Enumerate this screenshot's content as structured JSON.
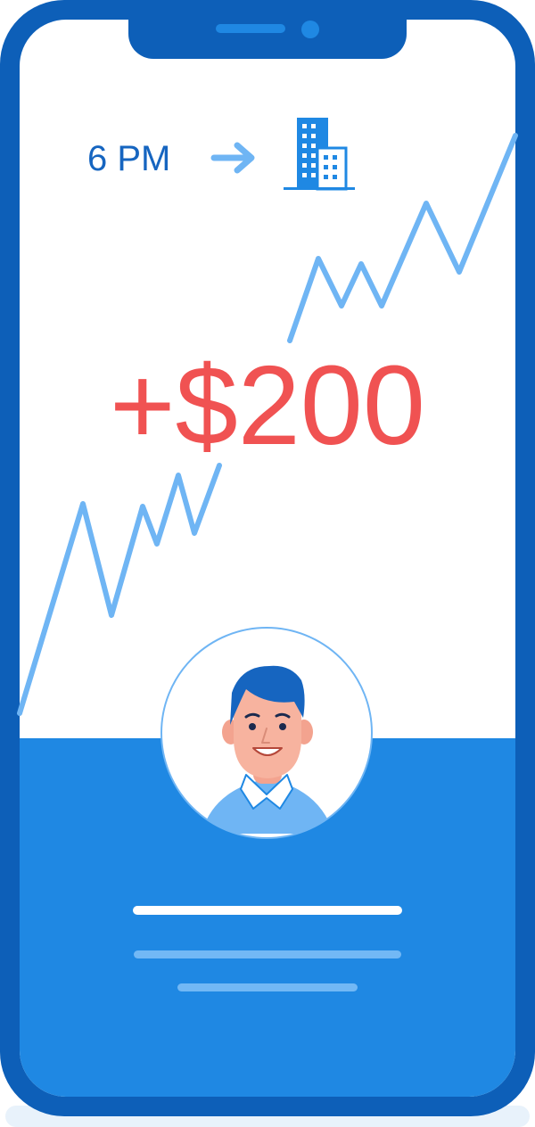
{
  "time": {
    "label": "6 PM"
  },
  "gain": {
    "amount": "+$200"
  },
  "icons": {
    "arrow": "arrow-right-icon",
    "building": "office-building-icon",
    "avatar": "user-avatar-icon"
  },
  "colors": {
    "frame": "#0d5fb8",
    "screen_accent": "#1f88e3",
    "trend_line": "#6fb5f4",
    "amount": "#f05252",
    "time_text": "#1665c0"
  }
}
